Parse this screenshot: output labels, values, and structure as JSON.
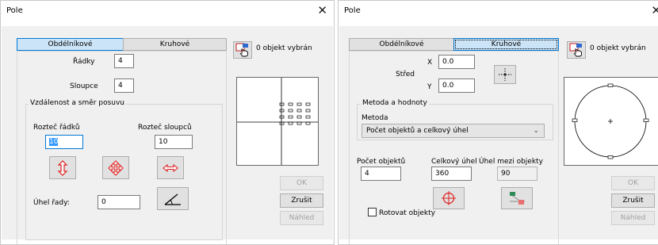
{
  "left": {
    "title": "Pole",
    "close": "✕",
    "tabs": [
      "Obdélníkové",
      "Kruhové"
    ],
    "selection_status": "0 objekt vybrán",
    "rows_label": "Řádky",
    "rows_value": "4",
    "columns_label": "Sloupce",
    "columns_value": "4",
    "group_label": "Vzdálenost a směr posuvu",
    "row_spacing_label": "Rozteč řádků",
    "row_spacing_value": "10",
    "col_spacing_label": "Rozteč sloupců",
    "col_spacing_value": "10",
    "row_angle_label": "Úhel řady:",
    "row_angle_value": "0",
    "ok": "OK",
    "cancel": "Zrušit",
    "preview": "Náhled",
    "icons": [
      "pick-objects-icon",
      "vertical-spacing-icon",
      "both-spacing-icon",
      "horizontal-spacing-icon",
      "angle-icon"
    ]
  },
  "right": {
    "title": "Pole",
    "close": "✕",
    "tabs": [
      "Obdélníkové",
      "Kruhové"
    ],
    "selection_status": "0 objekt vybrán",
    "center_label": "Střed",
    "x_label": "X",
    "x_value": "0.0",
    "y_label": "Y",
    "y_value": "0.0",
    "method_group_label": "Metoda a hodnoty",
    "method_label": "Metoda",
    "method_value": "Počet objektů a celkový úhel",
    "count_label": "Počet objektů",
    "count_value": "4",
    "total_angle_label": "Celkový úhel",
    "total_angle_value": "360",
    "between_angle_label": "Úhel mezi objekty",
    "between_angle_value": "90",
    "rotate_label": "Rotovat objekty",
    "ok": "OK",
    "cancel": "Zrušit",
    "preview": "Náhled",
    "icons": [
      "pick-objects-icon",
      "pick-center-icon",
      "pick-angle-icon",
      "pick-distance-icon"
    ]
  }
}
